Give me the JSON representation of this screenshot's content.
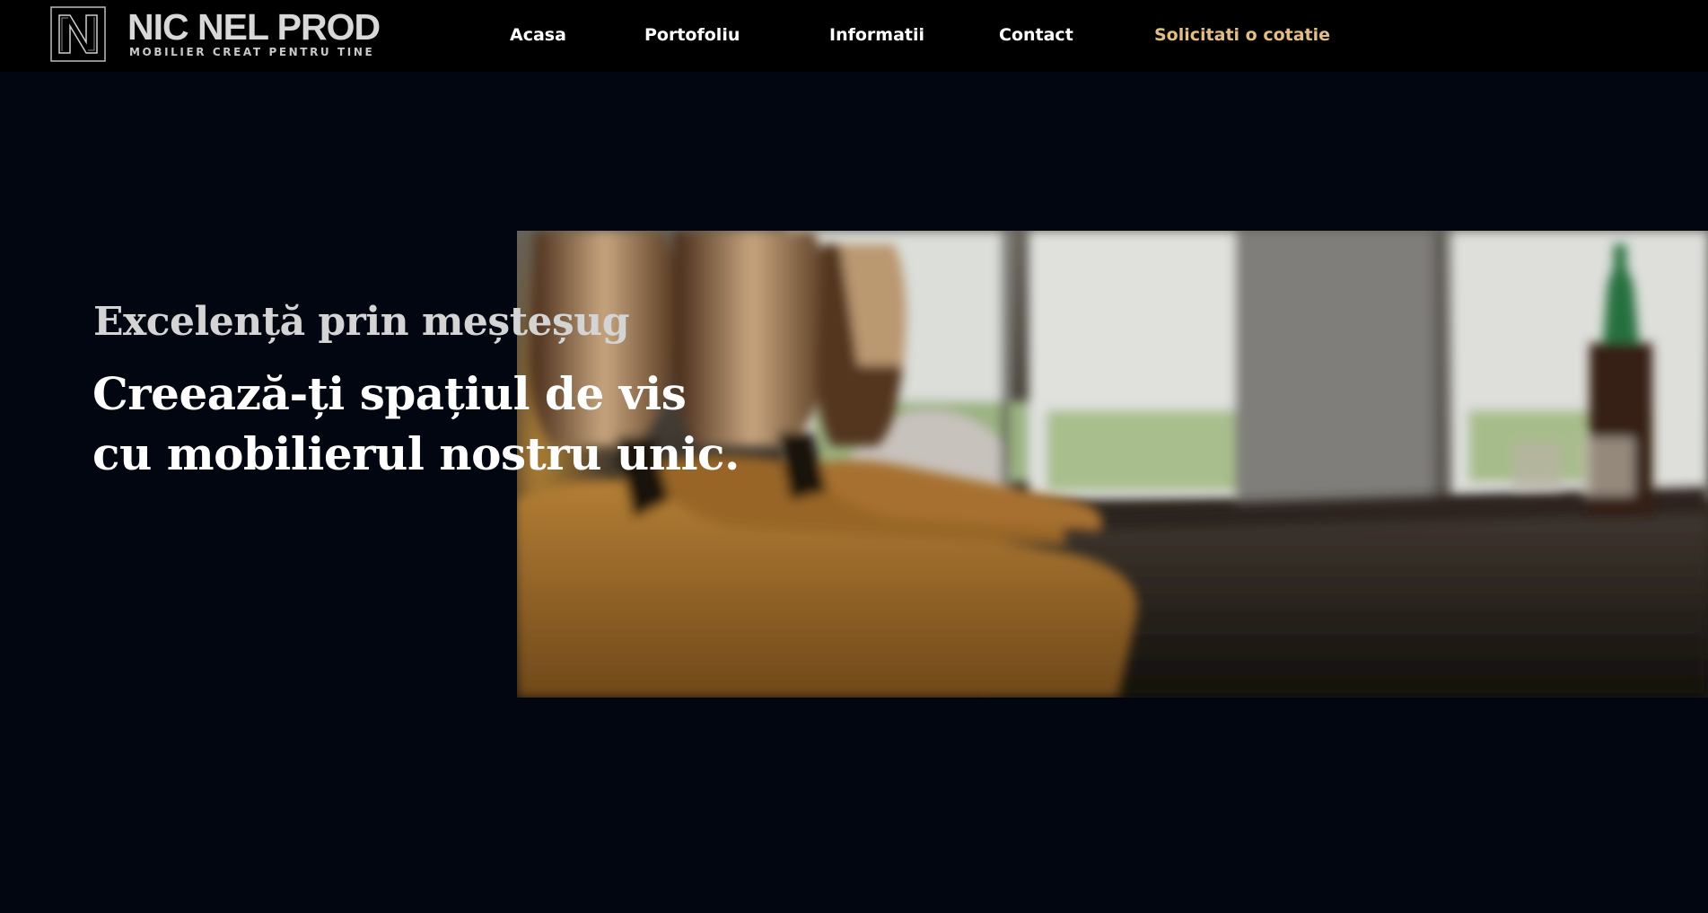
{
  "brand": {
    "name": "NIC NEL PROD",
    "tagline": "MOBILIER CREAT PENTRU TINE",
    "icon": "logo-n-monogram"
  },
  "nav": {
    "items": [
      {
        "label": "Acasa"
      },
      {
        "label": "Portofoliu"
      },
      {
        "label": "Informatii"
      },
      {
        "label": "Contact"
      }
    ],
    "cta": {
      "label": "Solicitati o cotatie"
    }
  },
  "hero": {
    "kicker": "Excelență prin meșteșug",
    "heading_line1": "Creează-ți spațiul de vis",
    "heading_line2": "cu mobilierul nostru unic."
  },
  "colors": {
    "background": "#020611",
    "header": "#000000",
    "cta_accent": "#e2bd86",
    "text_primary": "#ffffff",
    "text_muted": "#d4d4d4"
  }
}
